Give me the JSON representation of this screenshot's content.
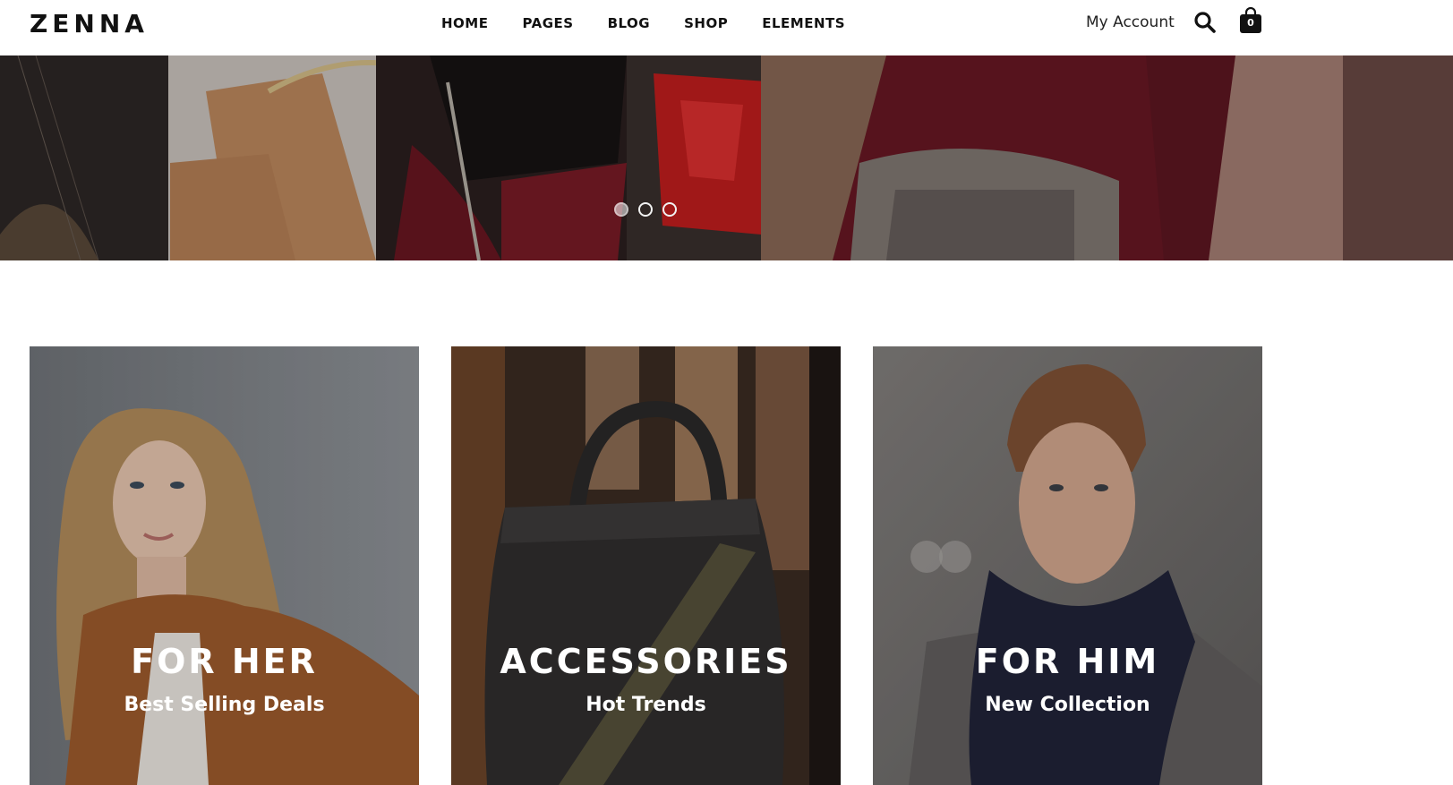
{
  "brand": {
    "logo": "ZENNA"
  },
  "nav": {
    "items": [
      {
        "label": "HOME"
      },
      {
        "label": "PAGES"
      },
      {
        "label": "BLOG"
      },
      {
        "label": "SHOP"
      },
      {
        "label": "ELEMENTS"
      }
    ]
  },
  "header": {
    "account_label": "My Account",
    "search_icon": "search-icon",
    "cart_icon": "shopping-bag-icon",
    "cart_count": "0"
  },
  "hero": {
    "slide_count": 3,
    "active_slide": 1
  },
  "categories": [
    {
      "title": "FOR HER",
      "subtitle": "Best Selling Deals"
    },
    {
      "title": "ACCESSORIES",
      "subtitle": "Hot Trends"
    },
    {
      "title": "FOR HIM",
      "subtitle": "New Collection"
    }
  ],
  "colors": {
    "text": "#111111",
    "background": "#ffffff",
    "overlay_text": "#ffffff"
  }
}
